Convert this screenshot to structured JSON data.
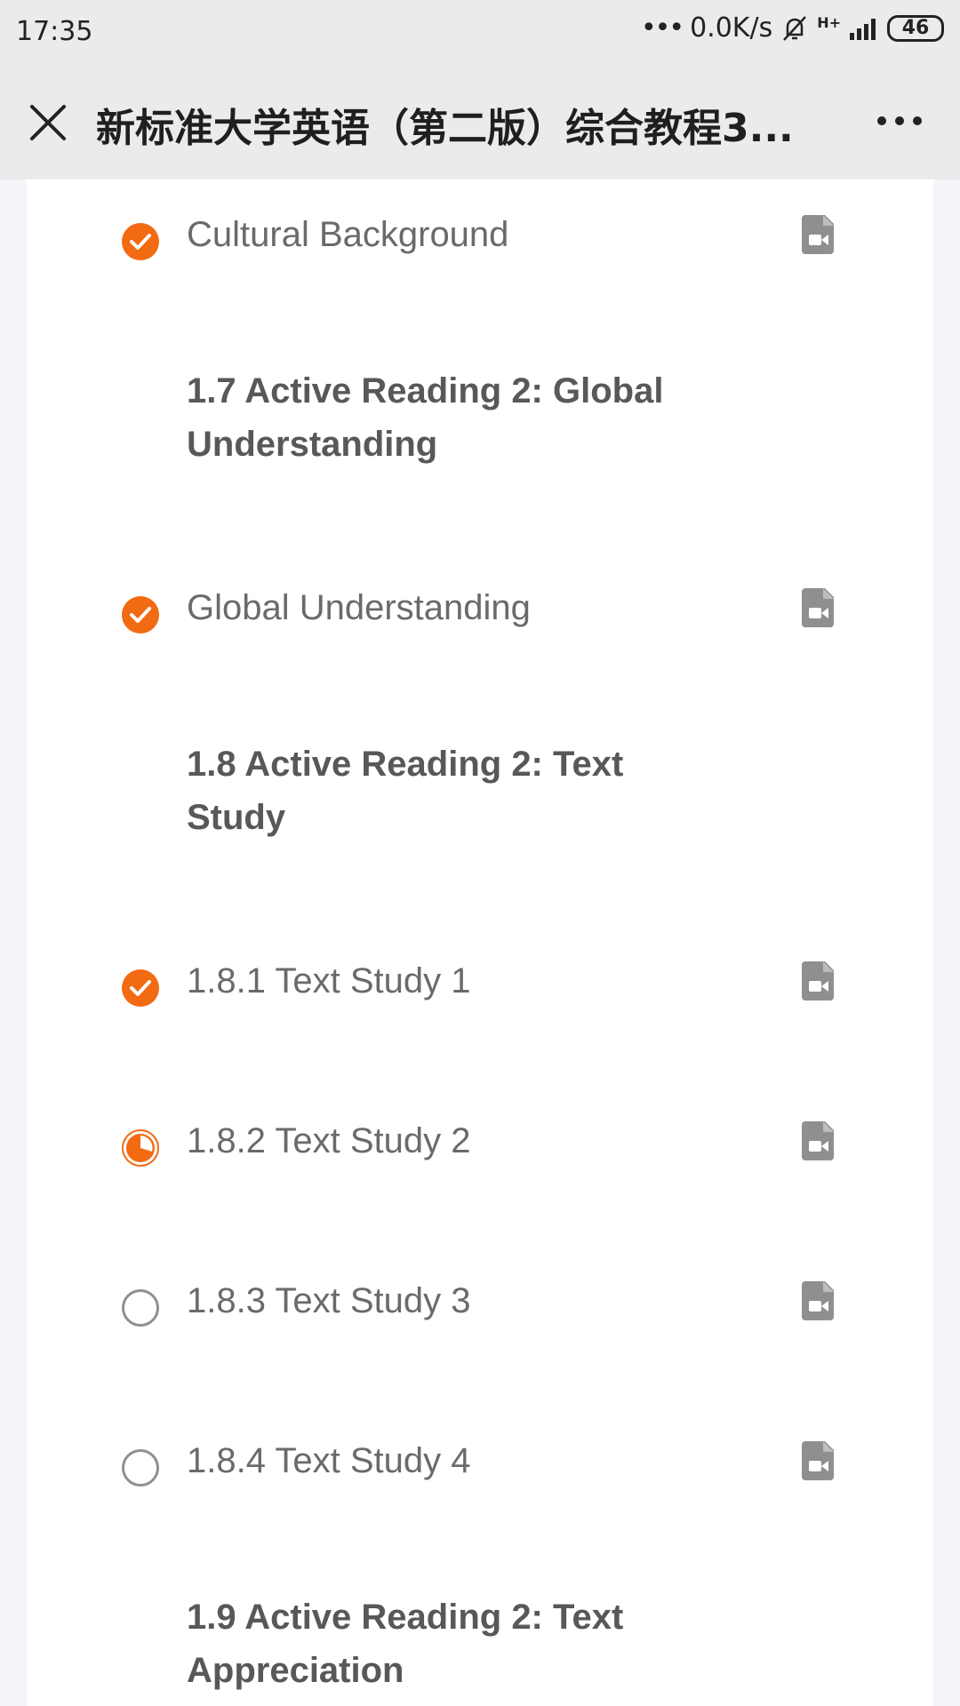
{
  "status_bar": {
    "time": "17:35",
    "net_speed": "0.0K/s",
    "signal": "H+",
    "battery": "46"
  },
  "header": {
    "title": "新标准大学英语（第二版）综合教程3..."
  },
  "colors": {
    "accent": "#f26a12",
    "icon_gray": "#8f8f8f"
  },
  "items": [
    {
      "type": "lesson",
      "label": "Cultural Background",
      "status": "done"
    },
    {
      "type": "section",
      "label": "1.7 Active Reading 2: Global Understanding"
    },
    {
      "type": "lesson",
      "label": "Global Understanding",
      "status": "done"
    },
    {
      "type": "section",
      "label": "1.8 Active Reading 2: Text Study"
    },
    {
      "type": "lesson",
      "label": "1.8.1 Text Study 1",
      "status": "done"
    },
    {
      "type": "lesson",
      "label": "1.8.2 Text Study 2",
      "status": "partial"
    },
    {
      "type": "lesson",
      "label": "1.8.3 Text Study 3",
      "status": "not_started"
    },
    {
      "type": "lesson",
      "label": "1.8.4 Text Study 4",
      "status": "not_started"
    },
    {
      "type": "section",
      "label": "1.9 Active Reading 2: Text Appreciation"
    }
  ]
}
